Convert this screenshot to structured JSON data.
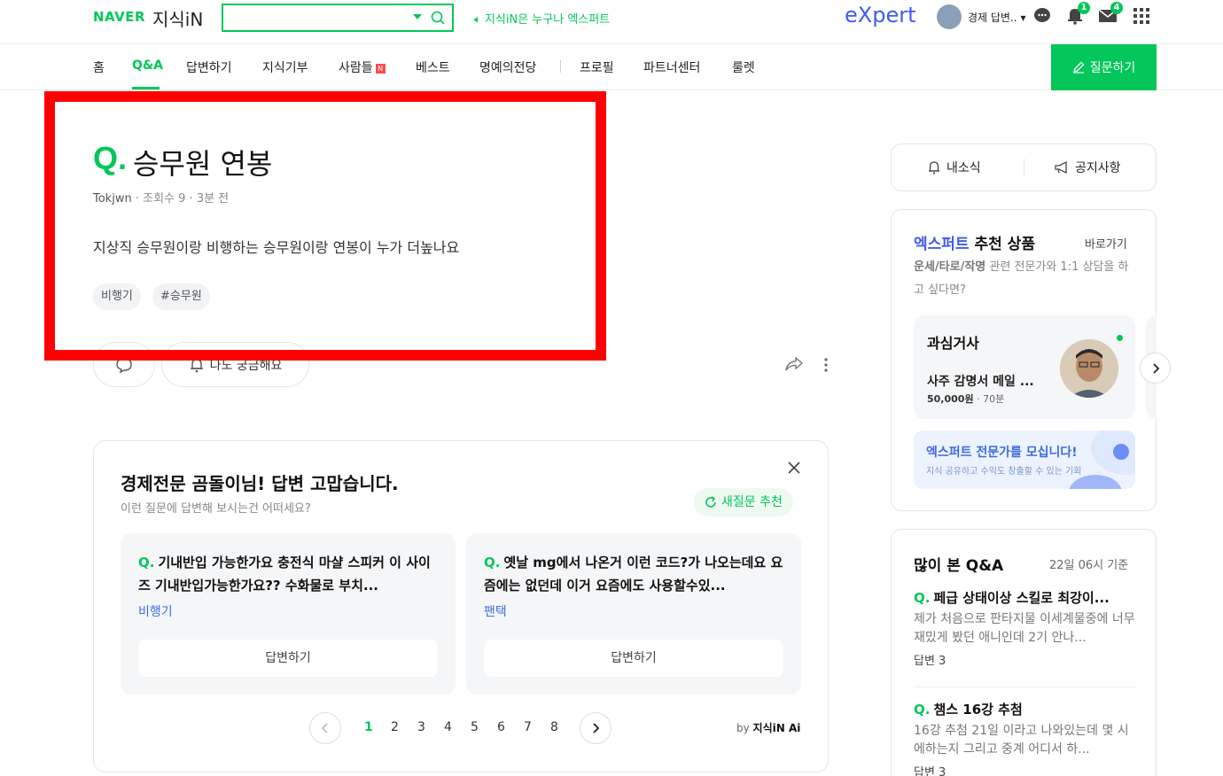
{
  "header": {
    "logo_naver": "NAVER",
    "logo_kin": "지식iN",
    "search_value": "",
    "promo": "지식iN은 누구나 엑스퍼트",
    "expert_logo": "eXpert",
    "user_label": "경제 답변..",
    "notif_badge": "1",
    "mail_badge": "4"
  },
  "nav": {
    "items": [
      "홈",
      "Q&A",
      "답변하기",
      "지식기부",
      "사람들",
      "베스트",
      "명예의전당",
      "프로필",
      "파트너센터",
      "룰렛"
    ],
    "new_badge": "N",
    "active": "Q&A",
    "ask_button": "질문하기"
  },
  "question": {
    "q_mark": "Q.",
    "title": "승무원 연봉",
    "author": "Tokjwn",
    "views": "조회수 9",
    "time": "3분 전",
    "body": "지상직 승무원이랑 비행하는 승무원이랑 연봉이 누가 더높나요",
    "tags": [
      "비행기",
      "#승무원"
    ],
    "curious_label": "나도 궁금해요"
  },
  "recommend": {
    "title": "경제전문 곰돌이님! 답변 고맙습니다.",
    "subtitle": "이런 질문에 답변해 보시는건 어떠세요?",
    "refresh_label": "새질문 추천",
    "items": [
      {
        "q": "Q.",
        "title": "기내반입 가능한가요 충전식 마샬 스피커 이 사이즈 기내반입가능한가요?? 수화물로 부치...",
        "category": "비행기",
        "answer_label": "답변하기"
      },
      {
        "q": "Q.",
        "title": "옛날 mg에서 나온거 이런 코드?가 나오는데요 요즘에는 없던데 이거 요즘에도 사용할수있...",
        "category": "팬택",
        "answer_label": "답변하기"
      }
    ],
    "pages": [
      "1",
      "2",
      "3",
      "4",
      "5",
      "6",
      "7",
      "8"
    ],
    "active_page": "1",
    "by_prefix": "by",
    "by_brand": "지식iN Ai"
  },
  "sidebar": {
    "my_news": "내소식",
    "notices": "공지사항",
    "expert": {
      "title_blue": "엑스퍼트",
      "title_rest": " 추천 상품",
      "shortcut": "바로가기",
      "desc_bold": "운세/타로/작명",
      "desc_rest": " 관련 전문가와 1:1 상담을 하고 싶다면?",
      "card_name": "과심거사",
      "card_product": "사주 감명서 메일 ...",
      "card_price": "50,000원",
      "card_duration": "70분",
      "recruit_title": "엑스퍼트 전문가를 모십니다!",
      "recruit_sub": "지식 공유하고 수익도 창출할 수 있는 기회"
    },
    "popular": {
      "title": "많이 본 Q&A",
      "time": "22일 06시 기준",
      "items": [
        {
          "q": "Q.",
          "title": "페급 상태이상 스킬로 최강이...",
          "desc": "제가 처음으로 판타지물 이세계물중에 너무 재밌게 봤던 애니인데 2기 안나...",
          "count": "답변 3"
        },
        {
          "q": "Q.",
          "title": "챔스 16강 추첨",
          "desc": "16강 추첨 21일 이라고 나와있는데 몇 시에하는지 그리고 중계 어디서 하...",
          "count": "답변 3"
        }
      ]
    }
  }
}
